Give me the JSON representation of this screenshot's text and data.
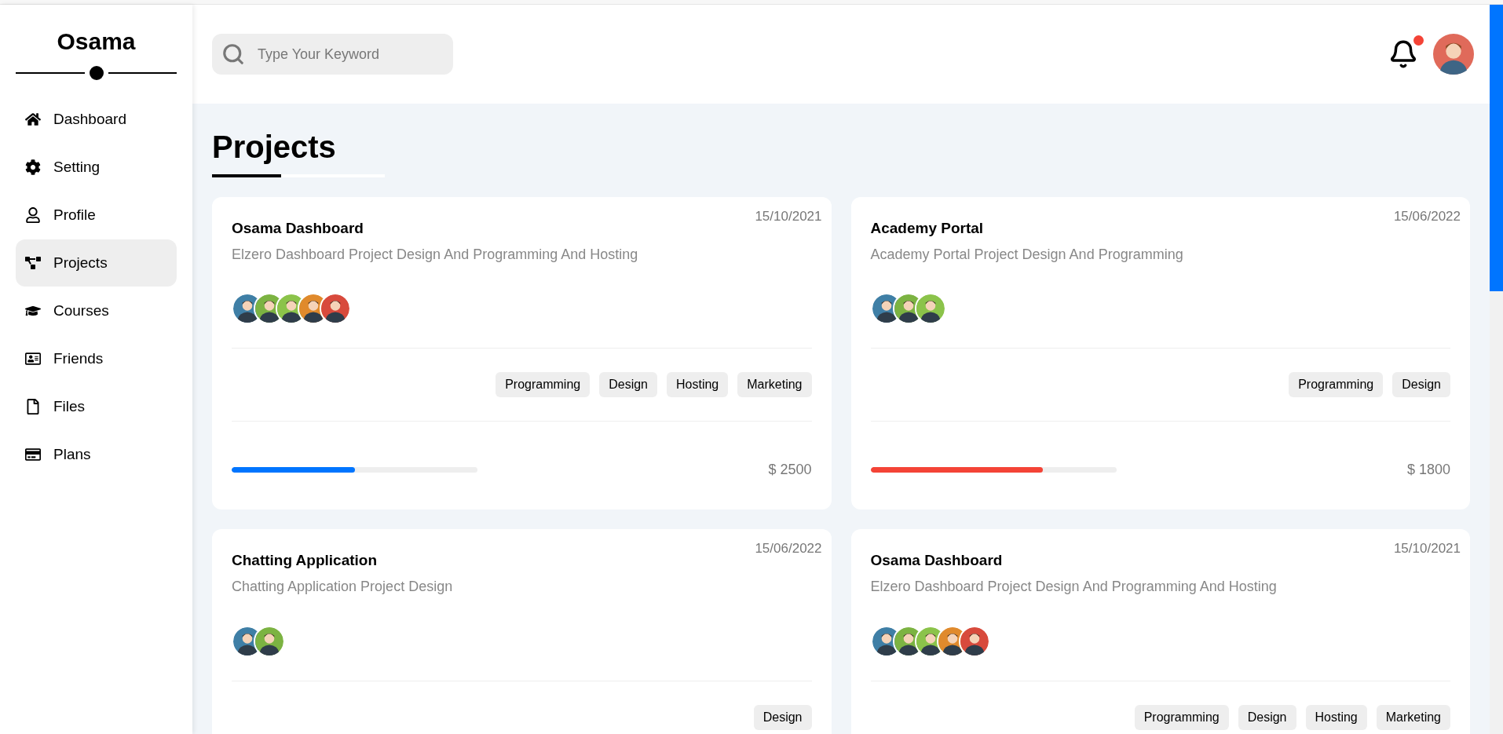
{
  "sidebar": {
    "title": "Osama",
    "items": [
      {
        "label": "Dashboard",
        "selected": false
      },
      {
        "label": "Setting",
        "selected": false
      },
      {
        "label": "Profile",
        "selected": false
      },
      {
        "label": "Projects",
        "selected": true
      },
      {
        "label": "Courses",
        "selected": false
      },
      {
        "label": "Friends",
        "selected": false
      },
      {
        "label": "Files",
        "selected": false
      },
      {
        "label": "Plans",
        "selected": false
      }
    ]
  },
  "header": {
    "search": {
      "placeholder": "Type Your Keyword"
    },
    "notifications": {
      "unread": true
    }
  },
  "page": {
    "title": "Projects"
  },
  "projects": [
    {
      "date": "15/10/2021",
      "title": "Osama Dashboard",
      "description": "Elzero Dashboard Project Design And Programming And Hosting",
      "members": [
        {
          "color": "#3f7fa6"
        },
        {
          "color": "#7cb342"
        },
        {
          "color": "#8bc34a"
        },
        {
          "color": "#e08a2c"
        },
        {
          "color": "#d84a3c"
        }
      ],
      "tags": [
        "Programming",
        "Design",
        "Hosting",
        "Marketing"
      ],
      "progress": {
        "level": 0.5,
        "color": "#0075ff"
      },
      "price": "$ 2500"
    },
    {
      "date": "15/06/2022",
      "title": "Academy Portal",
      "description": "Academy Portal Project Design And Programming",
      "members": [
        {
          "color": "#3f7fa6"
        },
        {
          "color": "#7cb342"
        },
        {
          "color": "#8bc34a"
        }
      ],
      "tags": [
        "Programming",
        "Design"
      ],
      "progress": {
        "level": 0.7,
        "color": "#f44336"
      },
      "price": "$ 1800"
    },
    {
      "date": "15/06/2022",
      "title": "Chatting Application",
      "description": "Chatting Application Project Design",
      "members": [
        {
          "color": "#3f7fa6"
        },
        {
          "color": "#7cb342"
        }
      ],
      "tags": [
        "Design"
      ]
    },
    {
      "date": "15/10/2021",
      "title": "Osama Dashboard",
      "description": "Elzero Dashboard Project Design And Programming And Hosting",
      "members": [
        {
          "color": "#3f7fa6"
        },
        {
          "color": "#7cb342"
        },
        {
          "color": "#8bc34a"
        },
        {
          "color": "#e08a2c"
        },
        {
          "color": "#d84a3c"
        }
      ],
      "tags": [
        "Programming",
        "Design",
        "Hosting",
        "Marketing"
      ]
    }
  ]
}
